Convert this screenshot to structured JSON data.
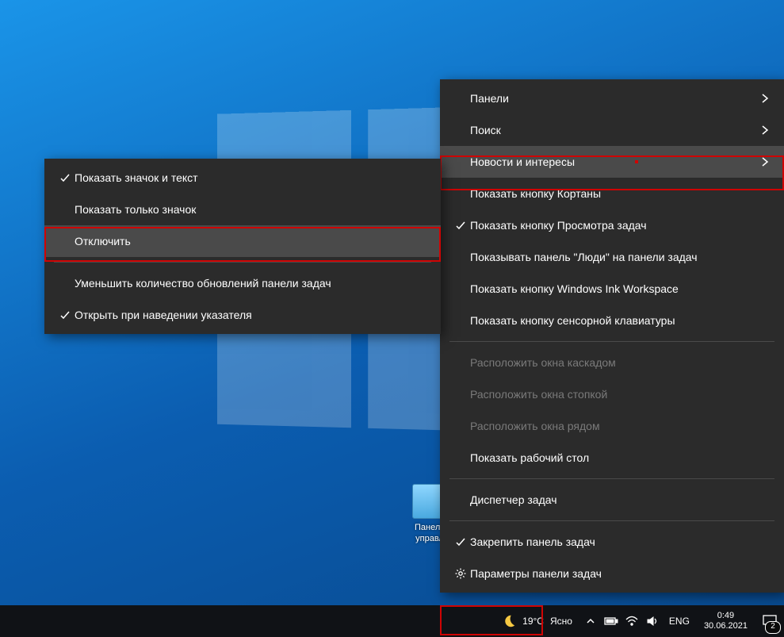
{
  "desktop_icon_label": "Панель\nуправл",
  "main_menu": {
    "items": [
      {
        "label": "Панели",
        "arrow": true
      },
      {
        "label": "Поиск",
        "arrow": true
      },
      {
        "label": "Новости и интересы",
        "arrow": true,
        "hover": true,
        "annot": true
      },
      {
        "label": "Показать кнопку Кортаны"
      },
      {
        "label": "Показать кнопку Просмотра задач",
        "checked": true
      },
      {
        "label": "Показывать панель \"Люди\" на панели задач"
      },
      {
        "label": "Показать кнопку Windows Ink Workspace"
      },
      {
        "label": "Показать кнопку сенсорной клавиатуры"
      },
      {
        "sep": true
      },
      {
        "label": "Расположить окна каскадом",
        "disabled": true
      },
      {
        "label": "Расположить окна стопкой",
        "disabled": true
      },
      {
        "label": "Расположить окна рядом",
        "disabled": true
      },
      {
        "label": "Показать рабочий стол"
      },
      {
        "sep": true
      },
      {
        "label": "Диспетчер задач"
      },
      {
        "sep": true
      },
      {
        "label": "Закрепить панель задач",
        "checked": true
      },
      {
        "label": "Параметры панели задач",
        "gear": true
      }
    ]
  },
  "sub_menu": {
    "items": [
      {
        "label": "Показать значок и текст",
        "checked": true
      },
      {
        "label": "Показать только значок"
      },
      {
        "label": "Отключить",
        "hover": true
      },
      {
        "sep": true
      },
      {
        "label": "Уменьшить количество обновлений панели задач"
      },
      {
        "label": "Открыть при наведении указателя",
        "checked": true
      }
    ]
  },
  "taskbar": {
    "weather_temp": "19°C",
    "weather_cond": "Ясно",
    "lang": "ENG",
    "time": "0:49",
    "date": "30.06.2021",
    "action_count": "2"
  }
}
